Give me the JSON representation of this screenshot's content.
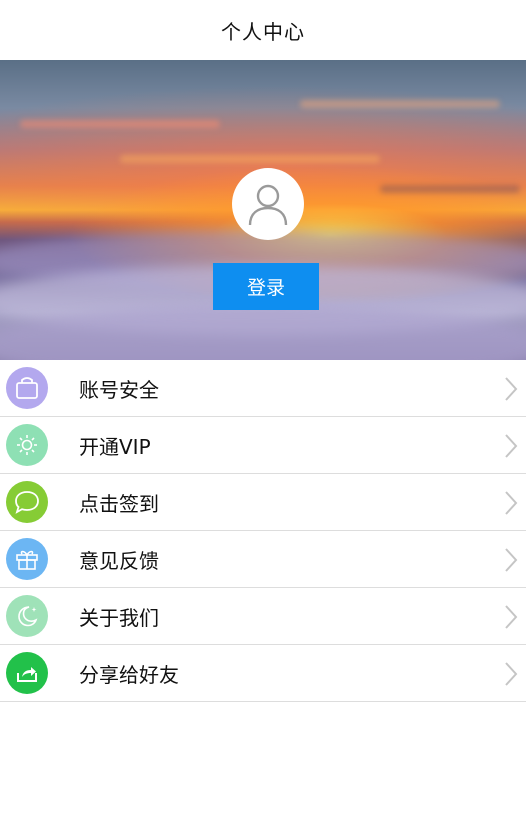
{
  "header": {
    "title": "个人中心"
  },
  "profile": {
    "login_label": "登录",
    "avatar_icon": "user-avatar-icon"
  },
  "menu": {
    "items": [
      {
        "label": "账号安全",
        "icon": "bag-icon",
        "color": "#b3a8ee"
      },
      {
        "label": "开通VIP",
        "icon": "sun-icon",
        "color": "#8ee0b4"
      },
      {
        "label": "点击签到",
        "icon": "chat-bubble-icon",
        "color": "#86cc35"
      },
      {
        "label": "意见反馈",
        "icon": "gift-icon",
        "color": "#6cb6f3"
      },
      {
        "label": "关于我们",
        "icon": "moon-icon",
        "color": "#9fe2b8"
      },
      {
        "label": "分享给好友",
        "icon": "share-icon",
        "color": "#22c14a"
      }
    ]
  },
  "colors": {
    "accent": "#0e8ef0",
    "divider": "#dddddd"
  }
}
